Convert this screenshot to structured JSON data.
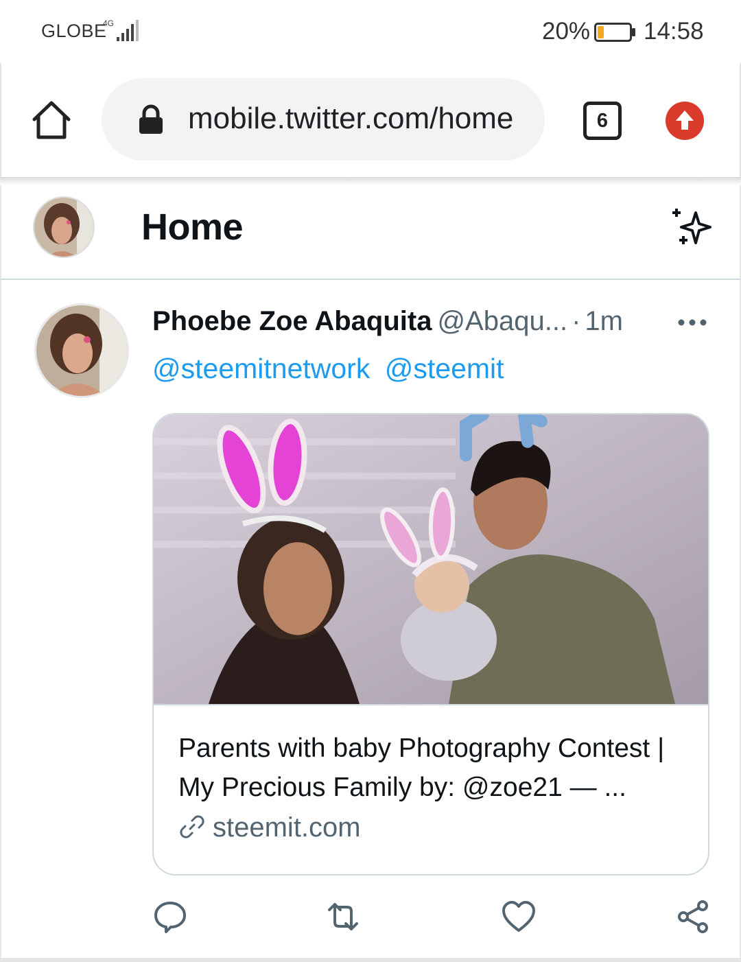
{
  "status_bar": {
    "carrier": "GLOBE",
    "network": "4G",
    "battery_percent": "20%",
    "battery_level": 0.2,
    "time": "14:58"
  },
  "browser": {
    "url": "mobile.twitter.com/home",
    "tab_count": "6",
    "icons": [
      "home-icon",
      "lock-icon",
      "tabs-icon",
      "update-icon"
    ],
    "accent_update": "#db3b2d"
  },
  "header": {
    "title": "Home",
    "icons": [
      "avatar",
      "sparkle-icon"
    ]
  },
  "tweet": {
    "author_name": "Phoebe Zoe Abaquita",
    "author_handle": "@Abaqu...",
    "separator": "·",
    "time": "1m",
    "mentions": [
      "@steemitnetwork",
      "@steemit"
    ],
    "card": {
      "title": "Parents with baby Photography Contest | My Precious Family by: @zoe21 — ...",
      "domain": "steemit.com"
    },
    "actions": [
      "reply-icon",
      "retweet-icon",
      "like-icon",
      "share-icon"
    ]
  },
  "colors": {
    "link": "#1d9bf0",
    "secondary_text": "#536471",
    "border": "#cfd9de"
  }
}
